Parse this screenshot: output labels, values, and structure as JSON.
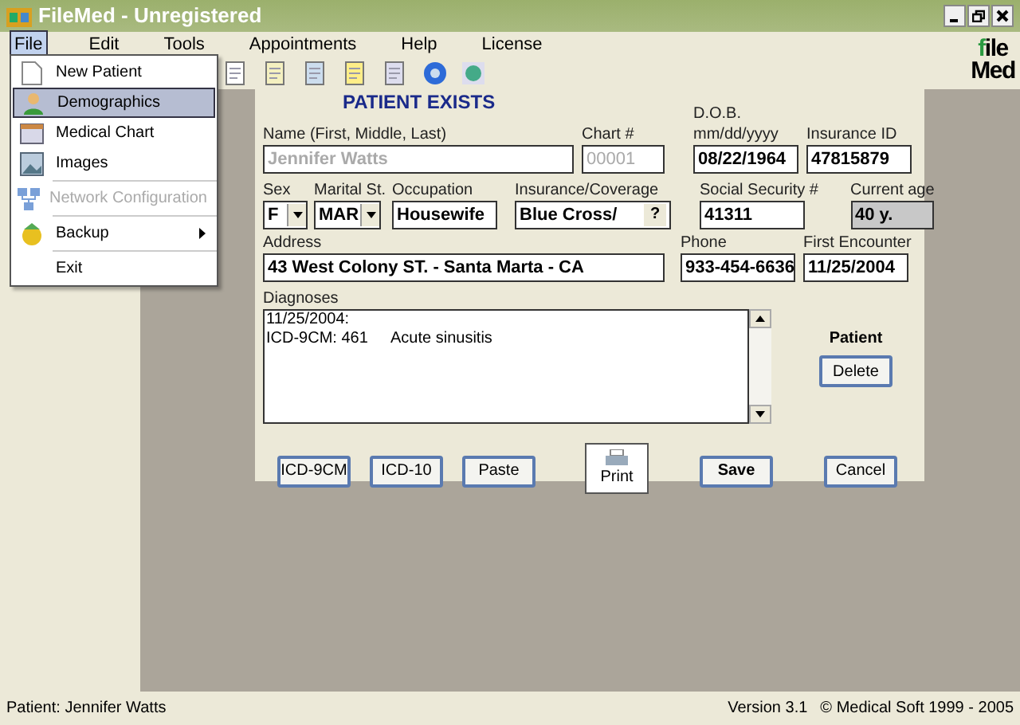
{
  "window": {
    "title": "FileMed - Unregistered"
  },
  "menu_bar": [
    {
      "label": "File",
      "selected": true
    },
    {
      "label": "Edit",
      "selected": false
    },
    {
      "label": "Tools",
      "selected": false
    },
    {
      "label": "Appointments",
      "selected": false
    },
    {
      "label": "Help",
      "selected": false
    },
    {
      "label": "License",
      "selected": false
    }
  ],
  "logo": {
    "mark": "f",
    "rest": "ile",
    "line2": "Med"
  },
  "file_menu": [
    {
      "kind": "item",
      "label": "New Patient",
      "selected": false,
      "disabled": false,
      "submenu": false
    },
    {
      "kind": "item",
      "label": "Demographics",
      "selected": true,
      "disabled": false,
      "submenu": false
    },
    {
      "kind": "item",
      "label": "Medical Chart",
      "selected": false,
      "disabled": false,
      "submenu": false
    },
    {
      "kind": "item",
      "label": "Images",
      "selected": false,
      "disabled": false,
      "submenu": false
    },
    {
      "kind": "separator"
    },
    {
      "kind": "item",
      "label": "Network Configuration",
      "selected": false,
      "disabled": true,
      "submenu": false
    },
    {
      "kind": "separator"
    },
    {
      "kind": "item",
      "label": "Backup",
      "selected": false,
      "disabled": false,
      "submenu": true
    },
    {
      "kind": "separator"
    },
    {
      "kind": "item",
      "label": "Exit",
      "selected": false,
      "disabled": false,
      "submenu": false
    }
  ],
  "form": {
    "heading": "PATIENT EXISTS",
    "name": {
      "label": "Name (First, Middle, Last)",
      "value": "Jennifer Watts",
      "disabled": true
    },
    "chart": {
      "label": "Chart #",
      "value": "00001",
      "disabled": true
    },
    "dob": {
      "label": "D.O.B.",
      "hint": "mm/dd/yyyy",
      "value": "08/22/1964"
    },
    "insurance_id": {
      "label": "Insurance ID",
      "value": "47815879"
    },
    "sex": {
      "label": "Sex",
      "value": "F"
    },
    "marital": {
      "label": "Marital St.",
      "value": "MAR"
    },
    "occupation": {
      "label": "Occupation",
      "value": "Housewife"
    },
    "coverage": {
      "label": "Insurance/Coverage",
      "value": "Blue Cross/",
      "button": "?"
    },
    "ssn": {
      "label": "Social Security #",
      "value": "41311"
    },
    "age": {
      "label": "Current age",
      "value": "40 y."
    },
    "address": {
      "label": "Address",
      "value": "43 West Colony ST. - Santa Marta - CA"
    },
    "phone": {
      "label": "Phone",
      "value": "933-454-6636"
    },
    "first_encounter": {
      "label": "First Encounter",
      "value": "11/25/2004"
    },
    "diagnoses": {
      "label": "Diagnoses",
      "lines": [
        {
          "code": "11/25/2004:"
        },
        {
          "code": "ICD-9CM: 461",
          "text": "Acute sinusitis"
        }
      ]
    },
    "patient_label": "Patient",
    "delete": "Delete",
    "buttons": [
      {
        "kind": "plain",
        "label": "ICD-9CM"
      },
      {
        "kind": "plain",
        "label": "ICD-10"
      },
      {
        "kind": "plain",
        "label": "Paste"
      },
      {
        "kind": "print",
        "label": "Print"
      },
      {
        "kind": "bold",
        "label": "Save"
      },
      {
        "kind": "plain",
        "label": "Cancel"
      }
    ]
  },
  "status_bar": {
    "left": "Patient: Jennifer Watts",
    "version": "Version 3.1",
    "copyright": "© Medical Soft 1999 - 2005"
  }
}
